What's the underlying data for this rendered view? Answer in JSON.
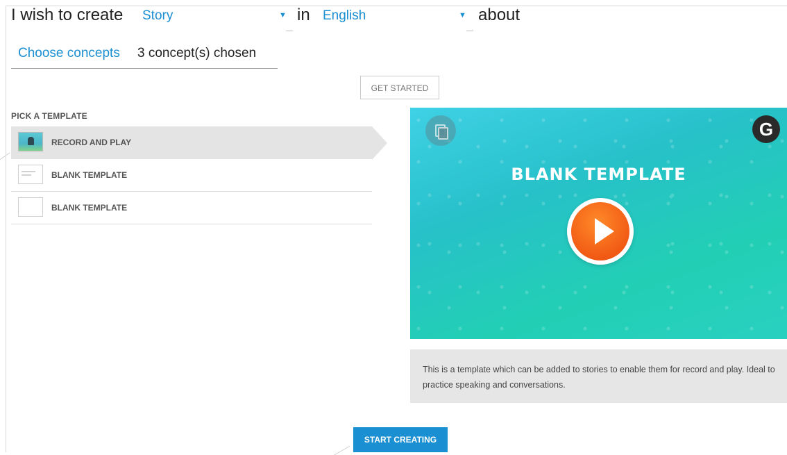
{
  "header": {
    "prefix": "I wish to create",
    "type_select": "Story",
    "in_text": "in",
    "language_select": "English",
    "suffix": "about"
  },
  "concepts": {
    "link_label": "Choose concepts",
    "count_label": "3 concept(s) chosen"
  },
  "get_started_label": "GET STARTED",
  "pick_template": {
    "title": "PICK A TEMPLATE",
    "items": [
      {
        "label": "RECORD AND PLAY",
        "active": true,
        "thumb": "scene"
      },
      {
        "label": "BLANK TEMPLATE",
        "active": false,
        "thumb": "lines"
      },
      {
        "label": "BLANK TEMPLATE",
        "active": false,
        "thumb": "empty"
      }
    ]
  },
  "preview": {
    "title": "BLANK TEMPLATE",
    "g_badge": "G",
    "description": "This is a template which can be added to stories to enable them for record and play. Ideal to practice speaking and conversations."
  },
  "start_creating_label": "START CREATING",
  "colors": {
    "accent": "#1a8fd1",
    "preview_bg": "#29c8c6",
    "play": "#f15a14"
  }
}
